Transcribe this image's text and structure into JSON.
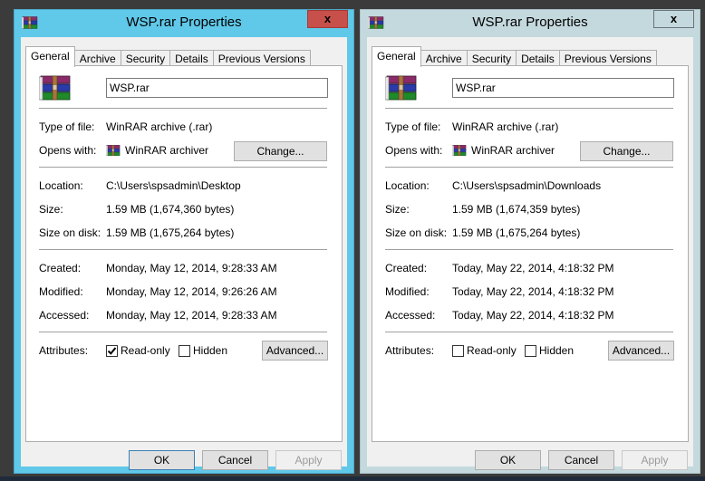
{
  "windows": [
    {
      "state": "active",
      "title": "WSP.rar Properties",
      "close_label": "x",
      "tabs": [
        "General",
        "Archive",
        "Security",
        "Details",
        "Previous Versions"
      ],
      "selected_tab": "General",
      "file_name": "WSP.rar",
      "type_of_file": {
        "label": "Type of file:",
        "value": "WinRAR archive (.rar)"
      },
      "opens_with": {
        "label": "Opens with:",
        "value": "WinRAR archiver",
        "button": "Change..."
      },
      "location": {
        "label": "Location:",
        "value": "C:\\Users\\spsadmin\\Desktop"
      },
      "size": {
        "label": "Size:",
        "value": "1.59 MB (1,674,360 bytes)"
      },
      "size_on_disk": {
        "label": "Size on disk:",
        "value": "1.59 MB (1,675,264 bytes)"
      },
      "created": {
        "label": "Created:",
        "value": "Monday, May 12, 2014, 9:28:33 AM"
      },
      "modified": {
        "label": "Modified:",
        "value": "Monday, May 12, 2014, 9:26:26 AM"
      },
      "accessed": {
        "label": "Accessed:",
        "value": "Monday, May 12, 2014, 9:28:33 AM"
      },
      "attributes": {
        "label": "Attributes:",
        "read_only": {
          "label": "Read-only",
          "checked": true
        },
        "hidden": {
          "label": "Hidden",
          "checked": false
        },
        "advanced_button": "Advanced..."
      },
      "buttons": {
        "ok": "OK",
        "cancel": "Cancel",
        "apply": "Apply"
      }
    },
    {
      "state": "inactive",
      "title": "WSP.rar Properties",
      "close_label": "x",
      "tabs": [
        "General",
        "Archive",
        "Security",
        "Details",
        "Previous Versions"
      ],
      "selected_tab": "General",
      "file_name": "WSP.rar",
      "type_of_file": {
        "label": "Type of file:",
        "value": "WinRAR archive (.rar)"
      },
      "opens_with": {
        "label": "Opens with:",
        "value": "WinRAR archiver",
        "button": "Change..."
      },
      "location": {
        "label": "Location:",
        "value": "C:\\Users\\spsadmin\\Downloads"
      },
      "size": {
        "label": "Size:",
        "value": "1.59 MB (1,674,359 bytes)"
      },
      "size_on_disk": {
        "label": "Size on disk:",
        "value": "1.59 MB (1,675,264 bytes)"
      },
      "created": {
        "label": "Created:",
        "value": "Today, May 22, 2014, 4:18:32 PM"
      },
      "modified": {
        "label": "Modified:",
        "value": "Today, May 22, 2014, 4:18:32 PM"
      },
      "accessed": {
        "label": "Accessed:",
        "value": "Today, May 22, 2014, 4:18:32 PM"
      },
      "attributes": {
        "label": "Attributes:",
        "read_only": {
          "label": "Read-only",
          "checked": false
        },
        "hidden": {
          "label": "Hidden",
          "checked": false
        },
        "advanced_button": "Advanced..."
      },
      "buttons": {
        "ok": "OK",
        "cancel": "Cancel",
        "apply": "Apply"
      }
    }
  ],
  "colors": {
    "active_frame": "#60c8e8",
    "inactive_frame": "#c4d9de",
    "close_active": "#c7504a",
    "desktop": "#3b3b3b"
  }
}
